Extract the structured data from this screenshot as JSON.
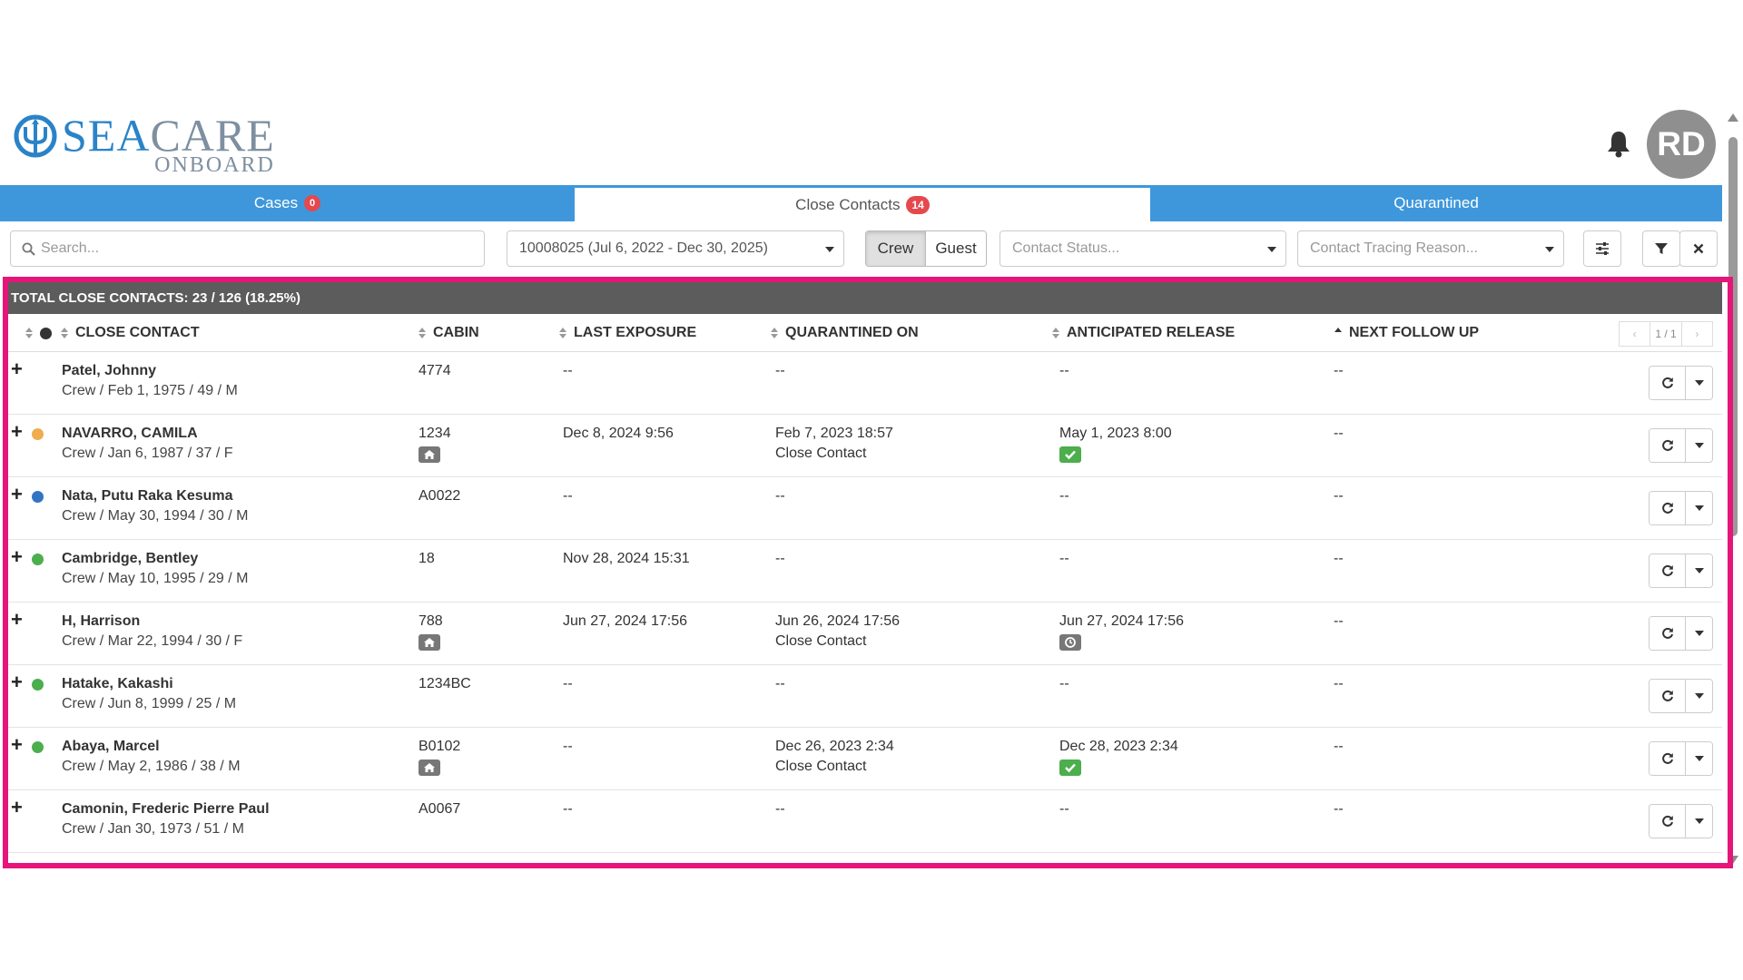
{
  "header": {
    "logo_sea": "SEA",
    "logo_care": "CARE",
    "logo_sub": "ONBOARD",
    "avatar_initials": "RD",
    "icons": {
      "logo": "trident-logo-icon",
      "notifications": "bell-icon"
    }
  },
  "tabs": [
    {
      "label": "Cases",
      "count": "0",
      "active": false
    },
    {
      "label": "Close Contacts",
      "count": "14",
      "active": true
    },
    {
      "label": "Quarantined",
      "active": false
    }
  ],
  "filters": {
    "search_placeholder": "Search...",
    "voyage": "10008025 (Jul 6, 2022 - Dec 30, 2025)",
    "segment": [
      "Crew",
      "Guest"
    ],
    "segment_selected": "Crew",
    "contact_status_placeholder": "Contact Status...",
    "reason_placeholder": "Contact Tracing Reason..."
  },
  "table": {
    "total_label": "TOTAL CLOSE CONTACTS: 23 / 126 (18.25%)",
    "columns": {
      "close_contact": "CLOSE CONTACT",
      "cabin": "CABIN",
      "last_exposure": "LAST EXPOSURE",
      "quarantined_on": "QUARANTINED ON",
      "anticipated_release": "ANTICIPATED RELEASE",
      "next_follow_up": "NEXT FOLLOW UP"
    },
    "pager": {
      "prev": "‹",
      "page": "1 / 1",
      "next": "›"
    },
    "rows": [
      {
        "name": "Patel, Johnny",
        "details": "Crew / Feb 1, 1975 / 49 / M",
        "status_color": null,
        "cabin": "4774",
        "cabin_icon": null,
        "last_exposure": "--",
        "quarantined_on": "--",
        "quarantine_reason": "",
        "anticipated_release": "--",
        "release_icon": null,
        "next_follow_up": "--"
      },
      {
        "name": "NAVARRO, CAMILA",
        "details": "Crew / Jan 6, 1987 / 37 / F",
        "status_color": "#f0ad4e",
        "cabin": "1234",
        "cabin_icon": "home-icon",
        "last_exposure": "Dec 8, 2024 9:56",
        "quarantined_on": "Feb 7, 2023 18:57",
        "quarantine_reason": "Close Contact",
        "anticipated_release": "May 1, 2023 8:00",
        "release_icon": "check-icon",
        "next_follow_up": "--"
      },
      {
        "name": "Nata, Putu Raka Kesuma",
        "details": "Crew / May 30, 1994 / 30 / M",
        "status_color": "#3373c4",
        "cabin": "A0022",
        "cabin_icon": null,
        "last_exposure": "--",
        "quarantined_on": "--",
        "quarantine_reason": "",
        "anticipated_release": "--",
        "release_icon": null,
        "next_follow_up": "--"
      },
      {
        "name": "Cambridge, Bentley",
        "details": "Crew / May 10, 1995 / 29 / M",
        "status_color": "#4cae4c",
        "cabin": "18",
        "cabin_icon": null,
        "last_exposure": "Nov 28, 2024 15:31",
        "quarantined_on": "--",
        "quarantine_reason": "",
        "anticipated_release": "--",
        "release_icon": null,
        "next_follow_up": "--"
      },
      {
        "name": "H, Harrison",
        "details": "Crew / Mar 22, 1994 / 30 / F",
        "status_color": null,
        "cabin": "788",
        "cabin_icon": "home-icon",
        "last_exposure": "Jun 27, 2024 17:56",
        "quarantined_on": "Jun 26, 2024 17:56",
        "quarantine_reason": "Close Contact",
        "anticipated_release": "Jun 27, 2024 17:56",
        "release_icon": "clock-icon",
        "next_follow_up": "--"
      },
      {
        "name": "Hatake, Kakashi",
        "details": "Crew / Jun 8, 1999 / 25 / M",
        "status_color": "#4cae4c",
        "cabin": "1234BC",
        "cabin_icon": null,
        "last_exposure": "--",
        "quarantined_on": "--",
        "quarantine_reason": "",
        "anticipated_release": "--",
        "release_icon": null,
        "next_follow_up": "--"
      },
      {
        "name": "Abaya, Marcel",
        "details": "Crew / May 2, 1986 / 38 / M",
        "status_color": "#4cae4c",
        "cabin": "B0102",
        "cabin_icon": "home-icon",
        "last_exposure": "--",
        "quarantined_on": "Dec 26, 2023 2:34",
        "quarantine_reason": "Close Contact",
        "anticipated_release": "Dec 28, 2023 2:34",
        "release_icon": "check-icon",
        "next_follow_up": "--"
      },
      {
        "name": "Camonin, Frederic Pierre Paul",
        "details": "Crew / Jan 30, 1973 / 51 / M",
        "status_color": null,
        "cabin": "A0067",
        "cabin_icon": null,
        "last_exposure": "--",
        "quarantined_on": "--",
        "quarantine_reason": "",
        "anticipated_release": "--",
        "release_icon": null,
        "next_follow_up": "--"
      }
    ],
    "row_icons": {
      "refresh": "refresh-icon",
      "menu": "caret-down-icon",
      "expand": "plus-icon"
    }
  },
  "colors": {
    "brand_blue": "#3e97db",
    "badge_red": "#e5484d",
    "highlight": "#e6157a",
    "total_bar": "#5c5c5c"
  }
}
